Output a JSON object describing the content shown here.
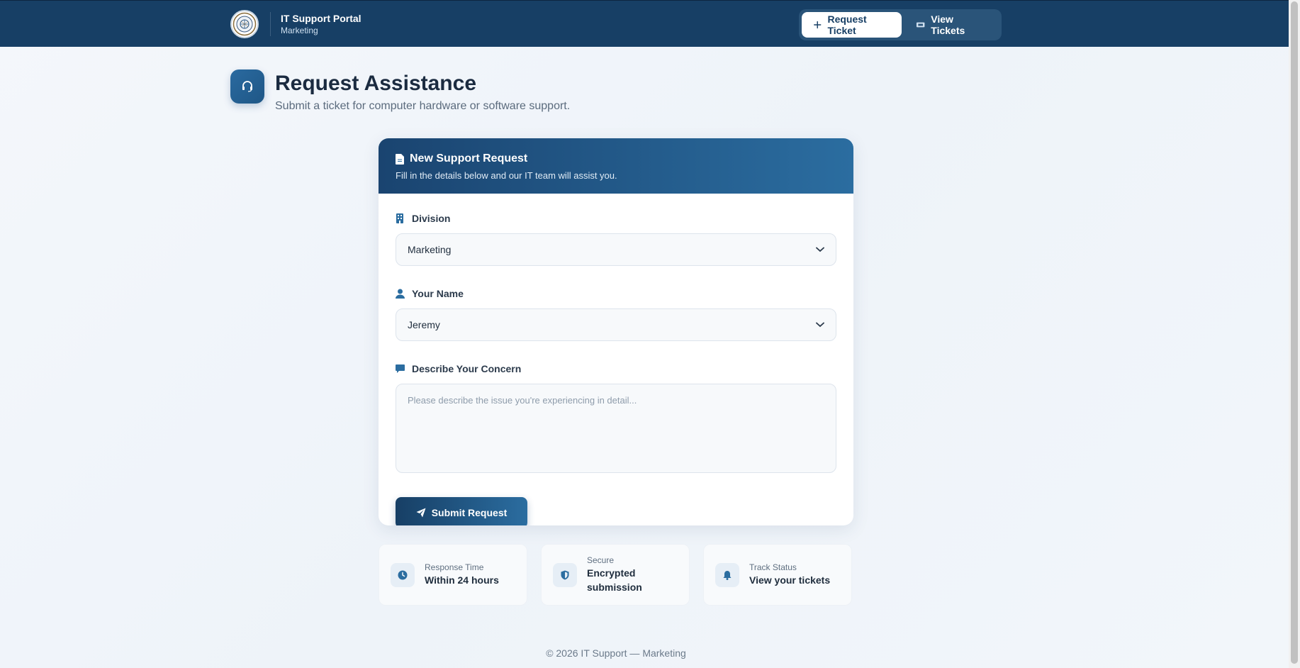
{
  "header": {
    "title": "IT Support Portal",
    "subtitle": "Marketing",
    "nav": [
      {
        "label": "Request Ticket",
        "icon": "plus-icon",
        "active": true
      },
      {
        "label": "View Tickets",
        "icon": "ticket-icon",
        "active": false
      }
    ]
  },
  "page": {
    "title": "Request Assistance",
    "subtitle": "Submit a ticket for computer hardware or software support.",
    "icon": "headset-icon"
  },
  "form": {
    "title": "New Support Request",
    "subtitle": "Fill in the details below and our IT team will assist you.",
    "division": {
      "label": "Division",
      "value": "Marketing",
      "icon": "building-icon"
    },
    "name": {
      "label": "Your Name",
      "value": "Jeremy",
      "icon": "user-icon"
    },
    "concern": {
      "label": "Describe Your Concern",
      "value": "",
      "placeholder": "Please describe the issue you're experiencing in detail...",
      "icon": "comment-icon"
    },
    "submit_label": "Submit Request"
  },
  "info": [
    {
      "label": "Response Time",
      "value": "Within 24 hours",
      "icon": "clock-icon"
    },
    {
      "label": "Secure",
      "value": "Encrypted submission",
      "icon": "shield-icon"
    },
    {
      "label": "Track Status",
      "value": "View your tickets",
      "icon": "bell-icon"
    }
  ],
  "footer": "© 2026 IT Support — Marketing",
  "colors": {
    "header_bg": "#173f65",
    "accent": "#2b6da0",
    "page_bg": "#f2f6fa"
  }
}
